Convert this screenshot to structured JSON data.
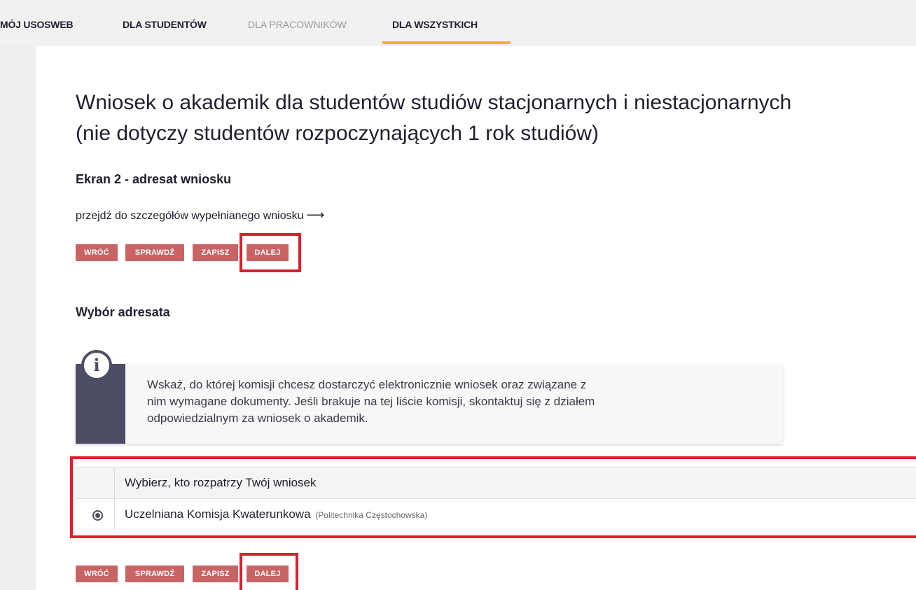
{
  "nav": {
    "items": [
      {
        "label": "MÓJ USOSWEB"
      },
      {
        "label": "DLA STUDENTÓW"
      },
      {
        "label": "DLA PRACOWNIKÓW"
      },
      {
        "label": "DLA WSZYSTKICH"
      }
    ],
    "active": "DLA WSZYSTKICH",
    "accent_color": "#f3b233"
  },
  "page": {
    "title_line1": "Wniosek o akademik dla studentów studiów stacjonarnych i niestacjonarnych",
    "title_line2": "(nie dotyczy studentów rozpoczynających 1 rok studiów)",
    "screen_heading": "Ekran 2 - adresat wniosku",
    "details_link": "przejdź do szczegółów wypełnianego wniosku",
    "details_link_icon": "arrow-right-icon"
  },
  "buttons": {
    "back": "WRÓĆ",
    "check": "SPRAWDŹ",
    "save": "ZAPISZ",
    "next": "DALEJ",
    "color": "#c86464"
  },
  "section": {
    "heading": "Wybór adresata"
  },
  "info": {
    "icon": "info-icon",
    "icon_glyph": "i",
    "text": "Wskaż, do której komisji chcesz dostarczyć elektronicznie wniosek oraz związane z nim wymagane dokumenty. Jeśli brakuje na tej liście komisji, skontaktuj się z działem odpowiedzialnym za wniosek o akademik."
  },
  "table": {
    "header": "Wybierz, kto rozpatrzy Twój wniosek",
    "rows": [
      {
        "name": "Uczelniana Komisja Kwaterunkowa",
        "org": "(Politechnika Częstochowska)",
        "selected": true
      }
    ]
  },
  "highlight_color": "#e01e2b"
}
